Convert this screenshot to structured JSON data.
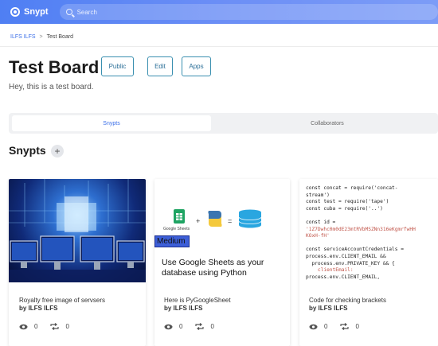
{
  "app": {
    "name": "Snypt"
  },
  "search": {
    "placeholder": "Search"
  },
  "breadcrumb": {
    "owner": "ILFS ILFS",
    "separator": ">",
    "current": "Test Board"
  },
  "board": {
    "title": "Test Board",
    "description": "Hey, this is a test board.",
    "buttons": {
      "public": "Public",
      "edit": "Edit",
      "apps": "Apps"
    }
  },
  "tabs": [
    {
      "label": "Snypts",
      "active": true
    },
    {
      "label": "Collaborators",
      "active": false
    }
  ],
  "section": {
    "title": "Snypts",
    "add": "+"
  },
  "cards": [
    {
      "title": "Royalty free image of servsers",
      "author": "by ILFS ILFS",
      "views": "0",
      "reposts": "0"
    },
    {
      "badge": "Medium",
      "headline": "Use Google Sheets as your database using Python",
      "sheets_label": "Google Sheets",
      "title": "Here is PyGoogleSheet",
      "author": "by ILFS ILFS",
      "views": "0",
      "reposts": "0"
    },
    {
      "code_lines": [
        "const concat = require('concat-",
        "stream')",
        "const test = require('tape')",
        "const cuba = require('..')",
        "",
        "const id =",
        "'1Z7Dwhc0m0dE23mtRVbMSZNn316eKgmrfwHH",
        "KOxH-fH'",
        "",
        "const serviceAccountCredentials =",
        "process.env.CLIENT_EMAIL &&",
        "  process.env.PRIVATE_KEY && {",
        "    clientEmail:",
        "process.env.CLIENT_EMAIL,"
      ],
      "title": "Code for checking brackets",
      "author": "by ILFS ILFS",
      "views": "0",
      "reposts": "0"
    }
  ],
  "colors": {
    "topbar": "#5a86f4",
    "link": "#3a6ee8",
    "button_border": "#3a8fb0"
  }
}
